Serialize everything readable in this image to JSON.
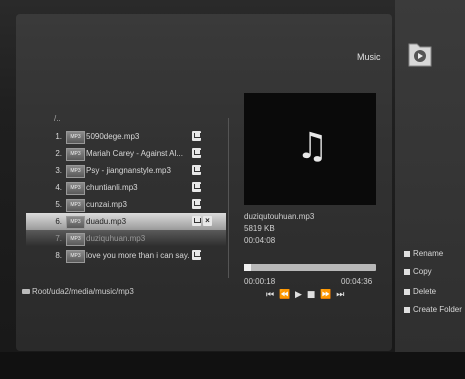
{
  "header": {
    "section_title": "Music",
    "folder_icon": "folder-music-icon"
  },
  "file_list": {
    "parent": "/..",
    "items": [
      {
        "num": "1.",
        "name": "5090dege.mp3",
        "state": "normal"
      },
      {
        "num": "2.",
        "name": "Mariah Carey - Against Al...",
        "state": "normal"
      },
      {
        "num": "3.",
        "name": "Psy - jiangnanstyle.mp3",
        "state": "normal"
      },
      {
        "num": "4.",
        "name": "chuntianli.mp3",
        "state": "normal"
      },
      {
        "num": "5.",
        "name": "cunzai.mp3",
        "state": "normal"
      },
      {
        "num": "6.",
        "name": "duadu.mp3",
        "state": "selected"
      },
      {
        "num": "7.",
        "name": "duziquhuan.mp3",
        "state": "playing"
      },
      {
        "num": "8.",
        "name": "love you more than i can say.",
        "state": "normal"
      }
    ],
    "path": "Root/uda2/media/music/mp3"
  },
  "player": {
    "file_name": "duziqutouhuan.mp3",
    "file_size": "5819 KB",
    "duration_info": "00:04:08",
    "elapsed": "00:00:18",
    "total": "00:04:36",
    "progress": 0.05,
    "controls": "⏮ ⏪ ▶ ■ ⏩ ⏭"
  },
  "menu": [
    {
      "label": "Rename"
    },
    {
      "label": "Copy"
    },
    {
      "label": "Delete"
    },
    {
      "label": "Create Folder"
    }
  ]
}
